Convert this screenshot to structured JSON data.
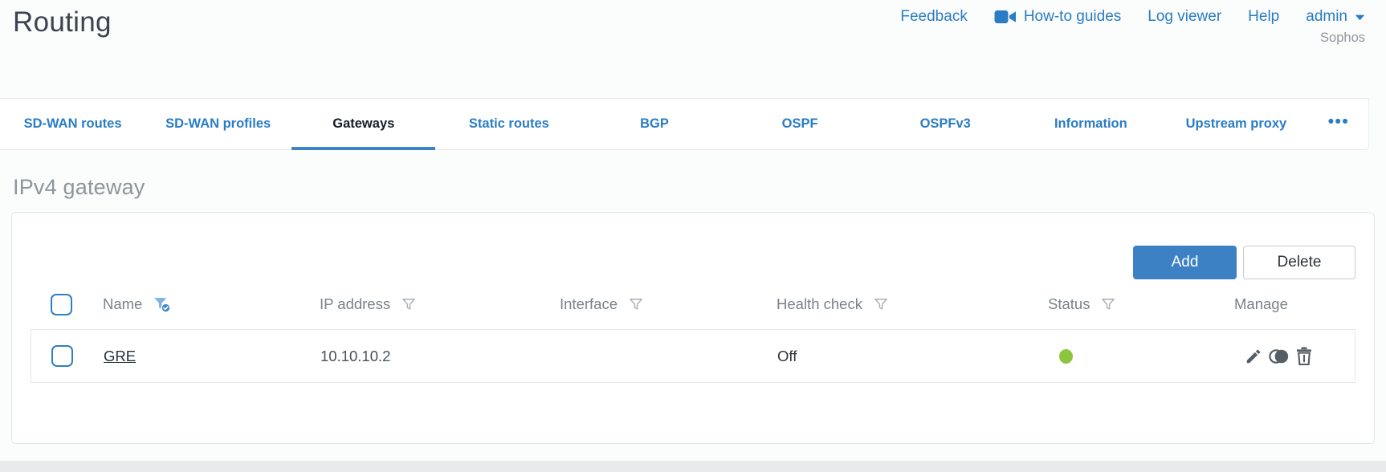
{
  "header": {
    "title": "Routing",
    "nav": {
      "feedback": "Feedback",
      "howto_guides": "How-to guides",
      "log_viewer": "Log viewer",
      "help": "Help",
      "user": "admin",
      "brand": "Sophos"
    }
  },
  "tabs": {
    "items": [
      {
        "label": "SD-WAN routes",
        "active": false
      },
      {
        "label": "SD-WAN profiles",
        "active": false
      },
      {
        "label": "Gateways",
        "active": true
      },
      {
        "label": "Static routes",
        "active": false
      },
      {
        "label": "BGP",
        "active": false
      },
      {
        "label": "OSPF",
        "active": false
      },
      {
        "label": "OSPFv3",
        "active": false
      },
      {
        "label": "Information",
        "active": false
      },
      {
        "label": "Upstream proxy",
        "active": false
      }
    ],
    "more_label": "•••"
  },
  "main": {
    "section_title": "IPv4 gateway",
    "toolbar": {
      "add_label": "Add",
      "delete_label": "Delete"
    },
    "table": {
      "columns": [
        {
          "label": "Name",
          "filter": "active"
        },
        {
          "label": "IP address",
          "filter": "inactive"
        },
        {
          "label": "Interface",
          "filter": "inactive"
        },
        {
          "label": "Health check",
          "filter": "inactive"
        },
        {
          "label": "Status",
          "filter": "inactive"
        },
        {
          "label": "Manage",
          "filter": "none"
        }
      ],
      "rows": [
        {
          "name": "GRE",
          "ip_address": "10.10.10.2",
          "interface": "",
          "health_check": "Off",
          "status": "green"
        }
      ]
    }
  },
  "icons": {
    "video_icon": "filled video camera glyph",
    "caret_down_icon": "▾ dropdown triangle",
    "more_icon": "••• horizontal ellipsis",
    "filter_icon": "funnel outline",
    "filter_active_icon": "blue funnel with check badge",
    "checkbox": "rounded blue-border checkbox, unchecked",
    "edit_pencil_icon": "pencil",
    "clone_icon": "two overlapping circles",
    "trash_icon": "trash can",
    "status_dot": "green circle"
  },
  "colors": {
    "link_blue": "#2a7cc4",
    "button_blue": "#3c81c4",
    "active_tab_underline": "#3c85c8",
    "status_green": "#8cc63f",
    "active_filter_fill": "#7fb2dd",
    "heading_gray": "#8d959b",
    "border_gray": "#e4e6e7"
  }
}
